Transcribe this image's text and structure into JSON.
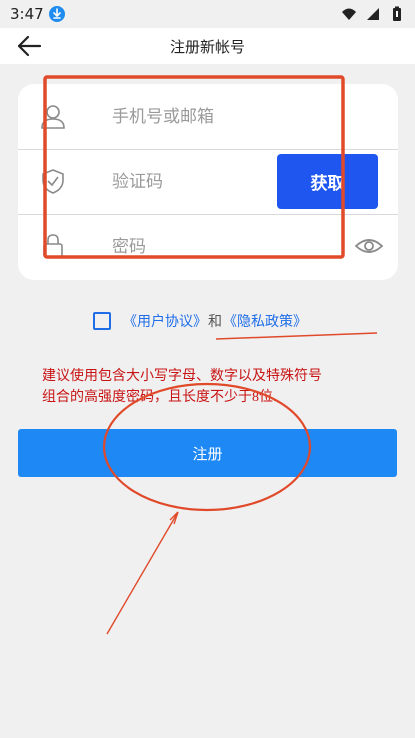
{
  "status_bar": {
    "time": "3:47"
  },
  "header": {
    "title": "注册新帐号"
  },
  "form": {
    "phone_placeholder": "手机号或邮箱",
    "code_placeholder": "验证码",
    "get_code_label": "获取",
    "password_placeholder": "密码"
  },
  "agreement": {
    "user_agreement": "《用户协议》",
    "and": "和",
    "privacy_policy": "《隐私政策》"
  },
  "hint": {
    "line1": "建议使用包含大小写字母、数字以及特殊符号",
    "line2": "组合的高强度密码，且长度不少于8位."
  },
  "register_label": "注册",
  "colors": {
    "primary": "#1e88f5",
    "get_code": "#1f56f0",
    "hint": "#c81414",
    "annotation": "#e04a2a"
  },
  "icons": [
    "download-icon",
    "wifi-icon",
    "signal-icon",
    "battery-icon",
    "back-arrow-icon",
    "user-icon",
    "shield-icon",
    "lock-icon",
    "eye-icon"
  ]
}
